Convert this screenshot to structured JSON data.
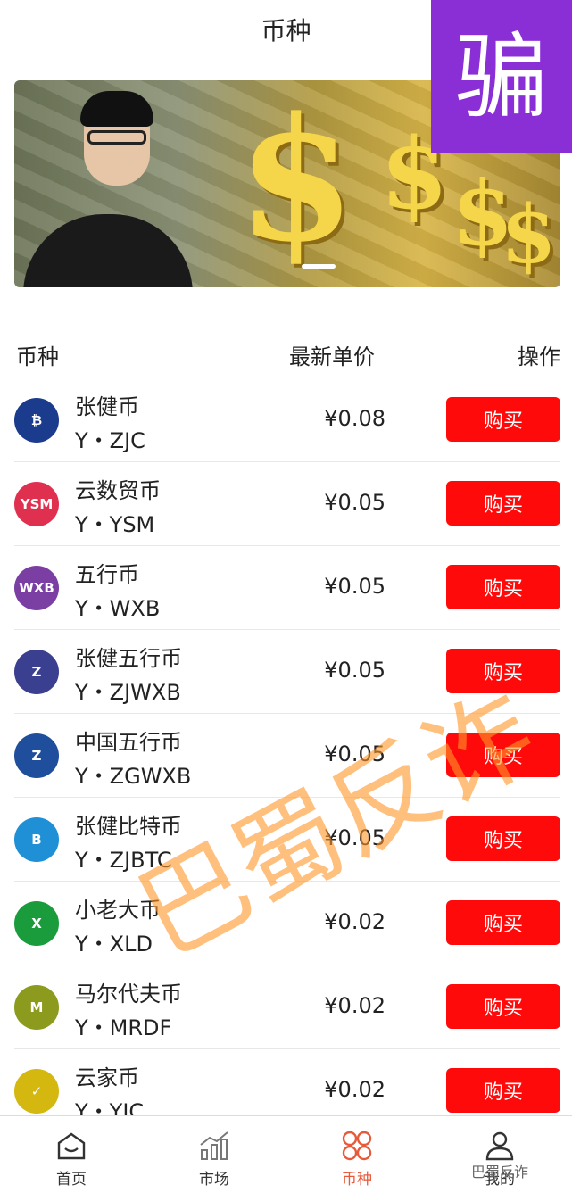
{
  "page": {
    "title": "币种"
  },
  "overlay": {
    "badge": "骗",
    "watermark": "巴蜀反诈",
    "account_mark": "巴蜀反诈"
  },
  "banner": {
    "symbol": "$"
  },
  "list_header": {
    "col_coin": "币种",
    "col_price": "最新单价",
    "col_action": "操作"
  },
  "coins": [
    {
      "name": "张健币",
      "code": "Y・ZJC",
      "price": "¥0.08",
      "icon_text": "₿",
      "icon_color": "#1b3b8c",
      "buy": "购买"
    },
    {
      "name": "云数贸币",
      "code": "Y・YSM",
      "price": "¥0.05",
      "icon_text": "YSM",
      "icon_color": "#e0304f",
      "buy": "购买"
    },
    {
      "name": "五行币",
      "code": "Y・WXB",
      "price": "¥0.05",
      "icon_text": "WXB",
      "icon_color": "#7b3fa3",
      "buy": "购买"
    },
    {
      "name": "张健五行币",
      "code": "Y・ZJWXB",
      "price": "¥0.05",
      "icon_text": "Z",
      "icon_color": "#3a3f8f",
      "buy": "购买"
    },
    {
      "name": "中国五行币",
      "code": "Y・ZGWXB",
      "price": "¥0.05",
      "icon_text": "Z",
      "icon_color": "#1f4e9c",
      "buy": "购买"
    },
    {
      "name": "张健比特币",
      "code": "Y・ZJBTC",
      "price": "¥0.05",
      "icon_text": "B",
      "icon_color": "#1f8fd6",
      "buy": "购买"
    },
    {
      "name": "小老大币",
      "code": "Y・XLD",
      "price": "¥0.02",
      "icon_text": "X",
      "icon_color": "#1a9b3c",
      "buy": "购买"
    },
    {
      "name": "马尔代夫币",
      "code": "Y・MRDF",
      "price": "¥0.02",
      "icon_text": "M",
      "icon_color": "#8c9a1e",
      "buy": "购买"
    },
    {
      "name": "云家币",
      "code": "Y・YJC",
      "price": "¥0.02",
      "icon_text": "✓",
      "icon_color": "#d4b70f",
      "buy": "购买"
    }
  ],
  "tabs": [
    {
      "label": "首页",
      "icon": "home-icon"
    },
    {
      "label": "市场",
      "icon": "chart-icon"
    },
    {
      "label": "币种",
      "icon": "coins-icon",
      "active": true
    },
    {
      "label": "我的",
      "icon": "user-icon"
    }
  ],
  "colors": {
    "buy_button": "#ff0a0a",
    "active_tab": "#e8593a",
    "badge": "#8a2fd6"
  }
}
